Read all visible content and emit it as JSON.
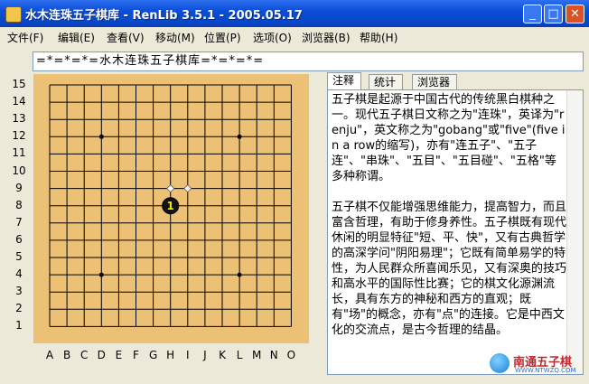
{
  "window": {
    "title": "水木连珠五子棋库 - RenLib 3.5.1 - 2005.05.17",
    "min_glyph": "_",
    "max_glyph": "□",
    "close_glyph": "✕"
  },
  "menu": [
    "文件(F)",
    "编辑(E)",
    "查看(V)",
    "移动(M)",
    "位置(P)",
    "选项(O)",
    "浏览器(B)",
    "帮助(H)"
  ],
  "comment_line": "=*=*=*=水木连珠五子棋库=*=*=*=",
  "board": {
    "size": 15,
    "row_labels": [
      "15",
      "14",
      "13",
      "12",
      "11",
      "10",
      "9",
      "8",
      "7",
      "6",
      "5",
      "4",
      "3",
      "2",
      "1"
    ],
    "col_labels": [
      "A",
      "B",
      "C",
      "D",
      "E",
      "F",
      "G",
      "H",
      "I",
      "J",
      "K",
      "L",
      "M",
      "N",
      "O"
    ],
    "star_points": [
      "D12",
      "L12",
      "H8",
      "D4",
      "L4"
    ],
    "stones": [
      {
        "pos": "H8",
        "color": "black",
        "number": "1"
      }
    ],
    "markers": [
      "H9",
      "I9"
    ]
  },
  "tabs": [
    {
      "label": "注释",
      "active": true
    },
    {
      "label": "统计",
      "active": false
    },
    {
      "label": "浏览器",
      "active": false
    }
  ],
  "comment_text": "五子棋是起源于中国古代的传统黑白棋种之一。现代五子棋日文称之为\"连珠\"，英译为\"renju\"，英文称之为\"gobang\"或\"five\"(five in a row的缩写)，亦有\"连五子\"、\"五子连\"、\"串珠\"、\"五目\"、\"五目碰\"、\"五格\"等多种称谓。\n\n五子棋不仅能增强思维能力，提高智力，而且富含哲理，有助于修身养性。五子棋既有现代休闲的明显特征\"短、平、快\"，又有古典哲学的高深学问\"阴阳易理\"；它既有简单易学的特性，为人民群众所喜闻乐见，又有深奥的技巧和高水平的国际性比赛；它的棋文化源渊流长，具有东方的神秘和西方的直观；既有\"场\"的概念，亦有\"点\"的连接。它是中西文化的交流点，是古今哲理的结晶。",
  "watermark": {
    "name": "南通五子棋",
    "url": "WWW.NTWZQ.COM"
  },
  "colors": {
    "board": "#ecc176",
    "title_bar": "#0a4ed8"
  }
}
